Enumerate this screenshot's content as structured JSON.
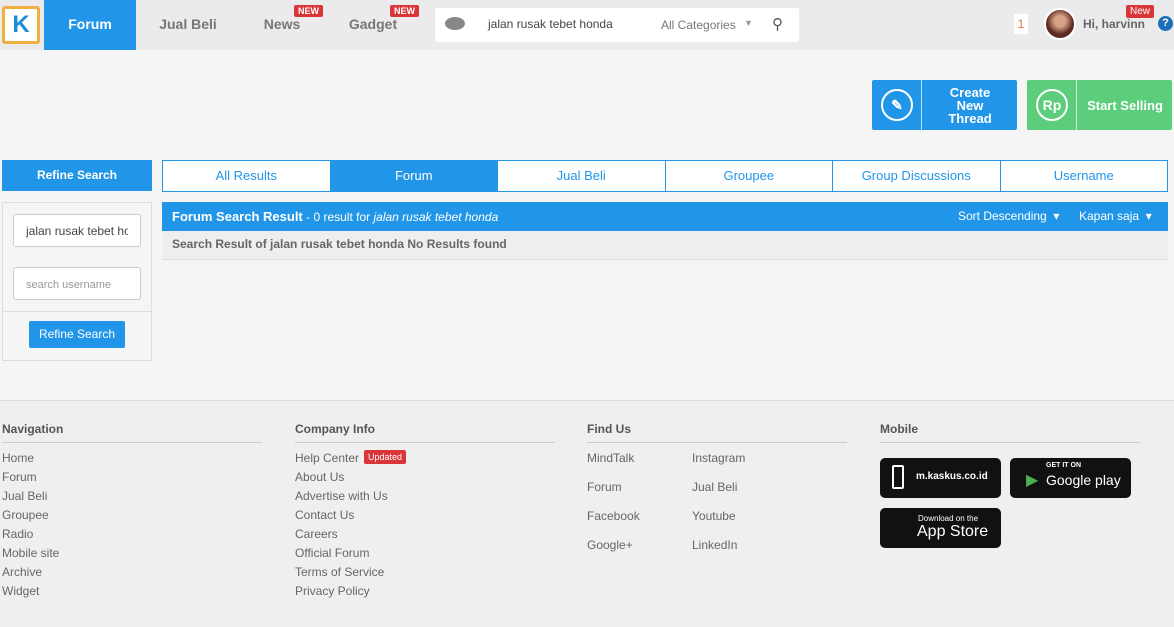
{
  "header": {
    "logo": "K",
    "nav": [
      {
        "label": "Forum"
      },
      {
        "label": "Jual Beli"
      },
      {
        "label": "News",
        "badge": "NEW"
      },
      {
        "label": "Gadget",
        "badge": "NEW"
      }
    ],
    "search": {
      "value": "jalan rusak tebet honda",
      "category": "All Categories"
    },
    "notifications": "1",
    "greeting": "Hi, harvinn",
    "new_badge": "New",
    "help": "?"
  },
  "actions": {
    "create": "Create New Thread",
    "sell": "Start Selling",
    "sell_icon": "Rp"
  },
  "refine": {
    "title": "Refine Search",
    "keyword": "jalan rusak tebet honda",
    "username_placeholder": "search username",
    "button": "Refine Search"
  },
  "tabs": [
    "All Results",
    "Forum",
    "Jual Beli",
    "Groupee",
    "Group Discussions",
    "Username"
  ],
  "results": {
    "title": "Forum Search Result",
    "count_text": "- 0 result for",
    "query": "jalan rusak tebet honda",
    "sort": "Sort Descending",
    "time": "Kapan saja",
    "message": "Search Result of jalan rusak tebet honda No Results found"
  },
  "footer": {
    "navigation": {
      "title": "Navigation",
      "links": [
        "Home",
        "Forum",
        "Jual Beli",
        "Groupee",
        "Radio",
        "Mobile site",
        "Archive",
        "Widget"
      ]
    },
    "company": {
      "title": "Company Info",
      "links": [
        "Help Center",
        "About Us",
        "Advertise with Us",
        "Contact Us",
        "Careers",
        "Official Forum",
        "Terms of Service",
        "Privacy Policy"
      ],
      "badge": "Updated"
    },
    "findus": {
      "title": "Find Us",
      "col1": [
        "MindTalk",
        "Forum",
        "Facebook",
        "Google+"
      ],
      "col2": [
        "Instagram",
        "Jual Beli",
        "Youtube",
        "LinkedIn"
      ]
    },
    "mobile": {
      "title": "Mobile",
      "site": "m.kaskus.co.id",
      "gp_small": "GET IT ON",
      "gp_big": "Google play",
      "as_small": "Download on the",
      "as_big": "App Store"
    }
  }
}
